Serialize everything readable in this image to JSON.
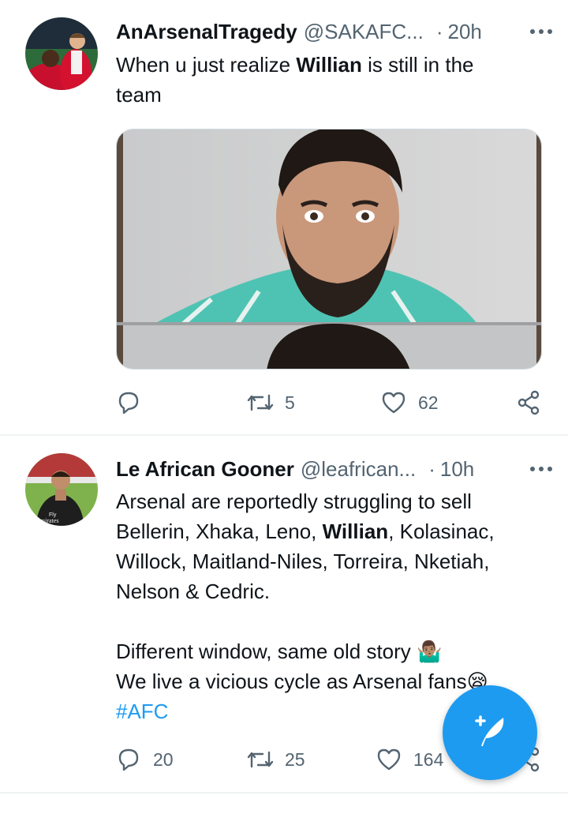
{
  "tweets": [
    {
      "display_name": "AnArsenalTragedy",
      "handle": "@SAKAFC...",
      "separator": "·",
      "time": "20h",
      "text": {
        "l1a": "When u just realize ",
        "l1b": "Willian",
        "l1c": " is still in the",
        "l2": "team"
      },
      "actions": {
        "reply_count": "",
        "retweet_count": "5",
        "like_count": "62"
      }
    },
    {
      "display_name": "Le African Gooner",
      "handle": "@leafrican...",
      "separator": "·",
      "time": "10h",
      "text": {
        "l1": "Arsenal are reportedly struggling to sell",
        "l2a": "Bellerin, Xhaka, Leno, ",
        "l2b": "Willian",
        "l2c": ", Kolasinac,",
        "l3": "Willock, Maitland-Niles, Torreira, Nketiah,",
        "l4": "Nelson & Cedric.",
        "l5a": "Different window, same old story ",
        "l5_emoji": "🤷🏽‍♂️",
        "l6a": "We live a vicious cycle as Arsenal fans",
        "l6_emoji": "😪",
        "hashtag": "#AFC"
      },
      "actions": {
        "reply_count": "20",
        "retweet_count": "25",
        "like_count": "164"
      }
    }
  ],
  "icons": {
    "more": "more-horizontal-icon",
    "reply": "reply-icon",
    "retweet": "retweet-icon",
    "like": "heart-icon",
    "share": "share-icon",
    "compose": "compose-tweet-icon"
  },
  "colors": {
    "accent": "#1d9bf0",
    "secondary_text": "#536471",
    "divider": "#eff3f4"
  }
}
